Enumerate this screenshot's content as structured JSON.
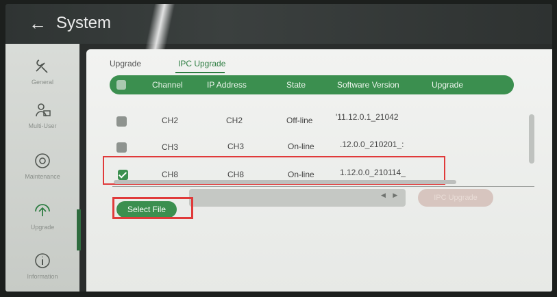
{
  "header": {
    "back_icon": "left-arrow-icon",
    "title": "System"
  },
  "sidebar": {
    "items": [
      {
        "label": "General",
        "icon": "wrench-screwdriver-icon"
      },
      {
        "label": "Multi-User",
        "icon": "users-icon"
      },
      {
        "label": "Maintenance",
        "icon": "maintenance-icon"
      },
      {
        "label": "Upgrade",
        "icon": "upgrade-icon",
        "active": true
      },
      {
        "label": "Information",
        "icon": "info-icon"
      }
    ]
  },
  "tabs": [
    {
      "label": "Upgrade",
      "active": false
    },
    {
      "label": "IPC Upgrade",
      "active": true
    }
  ],
  "table": {
    "columns": [
      "Channel",
      "IP Address",
      "State",
      "Software Version",
      "Upgrade"
    ],
    "rows": [
      {
        "channel": "CH2",
        "ip": "CH2",
        "state": "Off-line",
        "version": "'11.12.0.1_21042",
        "checked": false
      },
      {
        "channel": "CH3",
        "ip": "CH3",
        "state": "On-line",
        "version": ".12.0.0_210201_:",
        "checked": false
      },
      {
        "channel": "CH8",
        "ip": "CH8",
        "state": "On-line",
        "version": "1.12.0.0_210114_",
        "checked": true
      }
    ]
  },
  "actions": {
    "select_file": "Select File",
    "upgrade": "IPC Upgrade"
  },
  "colors": {
    "accent": "#3b8f4f",
    "highlight": "#e03a3a"
  }
}
